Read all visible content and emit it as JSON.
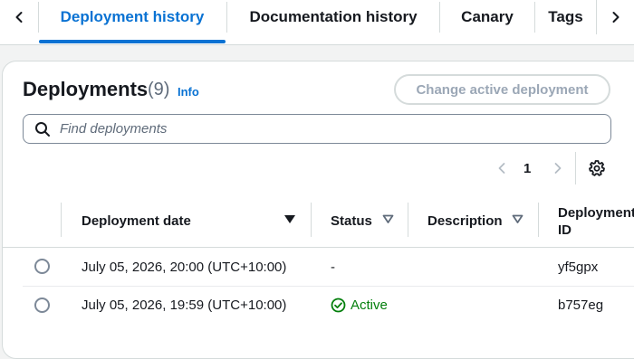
{
  "tabs": {
    "items": [
      {
        "label": "Deployment history",
        "active": true
      },
      {
        "label": "Documentation history",
        "active": false
      },
      {
        "label": "Canary",
        "active": false
      },
      {
        "label": "Tags",
        "active": false
      }
    ],
    "prev_icon": "chevron-left-icon",
    "next_icon": "chevron-right-icon"
  },
  "panel": {
    "title": "Deployments",
    "count": "(9)",
    "info_label": "Info",
    "change_button_label": "Change active deployment",
    "change_button_disabled": true
  },
  "search": {
    "placeholder": "Find deployments",
    "value": "",
    "icon": "search-icon"
  },
  "pagination": {
    "current_page": "1",
    "prev_disabled": true,
    "next_disabled": true,
    "settings_icon": "gear-icon"
  },
  "table": {
    "columns": [
      {
        "label": "Deployment date",
        "sort": "sorted-descending"
      },
      {
        "label": "Status",
        "sort": "sortable"
      },
      {
        "label": "Description",
        "sort": "sortable"
      },
      {
        "label_line1": "Deployment",
        "label_line2": "ID"
      }
    ],
    "rows": [
      {
        "date": "July 05, 2026, 20:00 (UTC+10:00)",
        "status": "-",
        "description": "",
        "id": "yf5gpx",
        "selected": false
      },
      {
        "date": "July 05, 2026, 19:59 (UTC+10:00)",
        "status": "Active",
        "description": "",
        "id": "b757eg",
        "selected": false
      }
    ]
  },
  "colors": {
    "accent": "#0972d3",
    "success": "#037f0c",
    "border": "#d5dbdb",
    "disabled_text": "#9ba7b6"
  }
}
